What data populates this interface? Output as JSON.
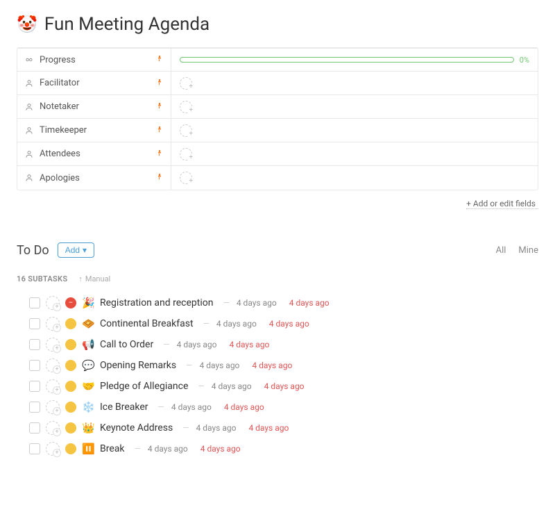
{
  "header": {
    "icon": "🤡",
    "title": "Fun Meeting Agenda"
  },
  "fields": [
    {
      "icon": "progress",
      "label": "Progress",
      "pinned": true,
      "type": "progress",
      "value": "0%"
    },
    {
      "icon": "person",
      "label": "Facilitator",
      "pinned": true,
      "type": "user"
    },
    {
      "icon": "person",
      "label": "Notetaker",
      "pinned": true,
      "type": "user"
    },
    {
      "icon": "person",
      "label": "Timekeeper",
      "pinned": true,
      "type": "user"
    },
    {
      "icon": "person",
      "label": "Attendees",
      "pinned": true,
      "type": "user"
    },
    {
      "icon": "person",
      "label": "Apologies",
      "pinned": true,
      "type": "user"
    }
  ],
  "add_fields_label": "+ Add or edit fields",
  "todo": {
    "title": "To Do",
    "add_label": "Add",
    "filters": [
      "All",
      "Mine"
    ]
  },
  "subtasks_meta": {
    "count_label": "16 SUBTASKS",
    "sort_label": "Manual"
  },
  "subtasks": [
    {
      "priority": "red",
      "emoji": "🎉",
      "name": "Registration and reception",
      "created": "4 days ago",
      "due": "4 days ago"
    },
    {
      "priority": "yellow",
      "emoji": "🧇",
      "name": "Continental Breakfast",
      "created": "4 days ago",
      "due": "4 days ago"
    },
    {
      "priority": "yellow",
      "emoji": "📢",
      "name": "Call to Order",
      "created": "4 days ago",
      "due": "4 days ago"
    },
    {
      "priority": "yellow",
      "emoji": "💬",
      "name": "Opening Remarks",
      "created": "4 days ago",
      "due": "4 days ago"
    },
    {
      "priority": "yellow",
      "emoji": "🤝",
      "name": "Pledge of Allegiance",
      "created": "4 days ago",
      "due": "4 days ago"
    },
    {
      "priority": "yellow",
      "emoji": "❄️",
      "name": "Ice Breaker",
      "created": "4 days ago",
      "due": "4 days ago"
    },
    {
      "priority": "yellow",
      "emoji": "👑",
      "name": "Keynote Address",
      "created": "4 days ago",
      "due": "4 days ago"
    },
    {
      "priority": "yellow",
      "emoji": "⏸️",
      "name": "Break",
      "created": "4 days ago",
      "due": "4 days ago"
    }
  ]
}
